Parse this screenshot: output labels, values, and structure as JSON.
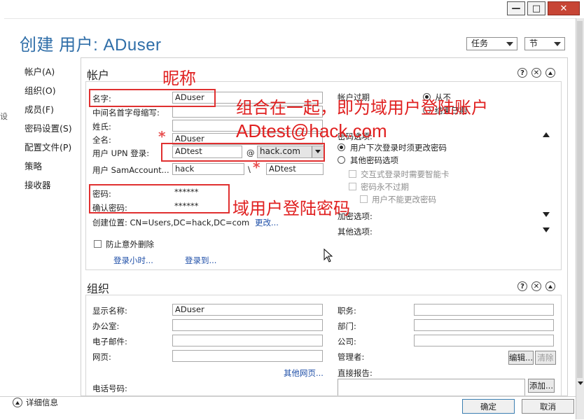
{
  "window": {
    "title": "创建 用户: ADuser",
    "controls": {
      "minimize": "—",
      "maximize": "□",
      "close": "✕"
    },
    "left_fragment": "设"
  },
  "header": {
    "tasks_label": "任务",
    "sections_label": "节"
  },
  "sidebar": {
    "items": [
      {
        "label": "帐户(A)"
      },
      {
        "label": "组织(O)"
      },
      {
        "label": "成员(F)"
      },
      {
        "label": "密码设置(S)"
      },
      {
        "label": "配置文件(P)"
      },
      {
        "label": "策略"
      },
      {
        "label": "接收器"
      }
    ]
  },
  "account": {
    "title": "帐户",
    "labels": {
      "name": "名字:",
      "initials": "中间名首字母缩写:",
      "surname": "姓氏:",
      "fullname": "全名:",
      "upn": "用户 UPN 登录:",
      "sam": "用户 SamAccount...",
      "password": "密码:",
      "confirm": "确认密码:",
      "location": "创建位置: CN=Users,DC=hack,DC=com",
      "change": "更改...",
      "protect": "防止意外删除",
      "logon_hours": "登录小时...",
      "logon_to": "登录到..."
    },
    "values": {
      "name": "ADuser",
      "initials": "",
      "surname": "",
      "fullname": "ADuser",
      "upn_user": "ADtest",
      "upn_at": "@",
      "upn_domain": "hack.com",
      "sam_domain": "hack",
      "sam_sep": "\\",
      "sam_user": "ADtest",
      "password": "******",
      "confirm": "******"
    },
    "right": {
      "expires": "帐户过期",
      "expires_never": "从不",
      "expires_end": "结束日期",
      "password_options": "密码选项:",
      "opt_change": "用户下次登录时须更改密码",
      "opt_other": "其他密码选项",
      "sub_smartcard": "交互式登录时需要智能卡",
      "sub_never_expire": "密码永不过期",
      "sub_cannot_change": "用户不能更改密码",
      "encryption": "加密选项:",
      "other_options": "其他选项:"
    }
  },
  "annotations": {
    "nickname": "昵称",
    "combined": "组合在一起，即为域用户登陆账户",
    "account_example": "ADtest@hack.com",
    "password_note": "域用户登陆密码",
    "star": "*"
  },
  "org": {
    "title": "组织",
    "labels": {
      "display_name": "显示名称:",
      "office": "办公室:",
      "email": "电子邮件:",
      "web": "网页:",
      "other_web": "其他网页...",
      "phone": "电话号码:",
      "job": "职务:",
      "department": "部门:",
      "company": "公司:",
      "manager": "管理者:",
      "edit": "编辑...",
      "clear": "清除",
      "direct_reports": "直接报告:",
      "add": "添加..."
    },
    "values": {
      "display_name": "ADuser"
    }
  },
  "footer": {
    "details": "详细信息",
    "ok": "确定",
    "cancel": "取消"
  },
  "icons": {
    "help": "?",
    "close": "✕",
    "collapse": "▲",
    "expand": "▼"
  },
  "colors": {
    "title_blue": "#2f6ea8",
    "annotation_red": "#e02020",
    "link_blue": "#1f4fa8",
    "close_red": "#c74535"
  }
}
